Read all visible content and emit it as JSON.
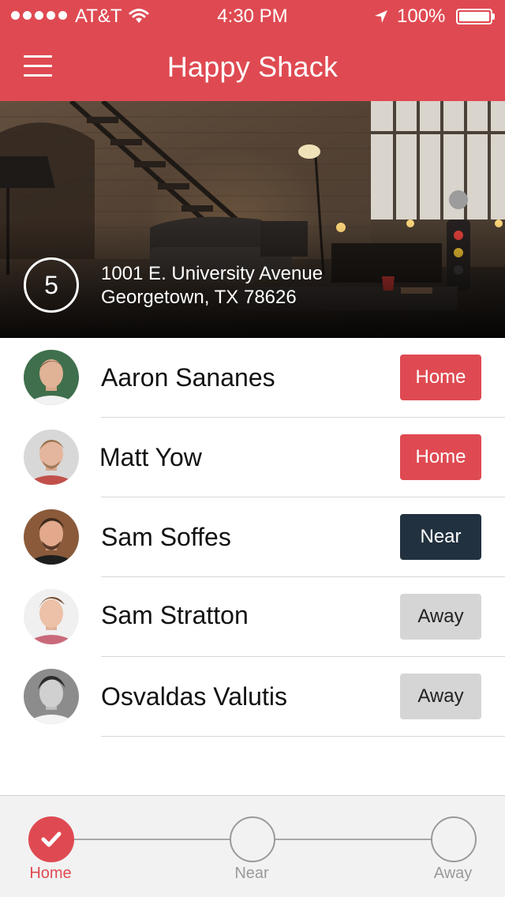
{
  "status_bar": {
    "carrier": "AT&T",
    "time": "4:30 PM",
    "battery": "100%"
  },
  "nav": {
    "title": "Happy Shack"
  },
  "hero": {
    "count": "5",
    "address_line1": "1001 E. University Avenue",
    "address_line2": "Georgetown, TX 78626"
  },
  "people": [
    {
      "name": "Aaron Sananes",
      "status": "Home"
    },
    {
      "name": "Matt Yow",
      "status": "Home"
    },
    {
      "name": "Sam Soffes",
      "status": "Near"
    },
    {
      "name": "Sam Stratton",
      "status": "Away"
    },
    {
      "name": "Osvaldas Valutis",
      "status": "Away"
    }
  ],
  "bottom_bar": {
    "steps": [
      {
        "label": "Home",
        "active": true
      },
      {
        "label": "Near",
        "active": false
      },
      {
        "label": "Away",
        "active": false
      }
    ]
  },
  "colors": {
    "accent": "#df4a52",
    "near": "#223140",
    "away": "#d5d5d5"
  }
}
